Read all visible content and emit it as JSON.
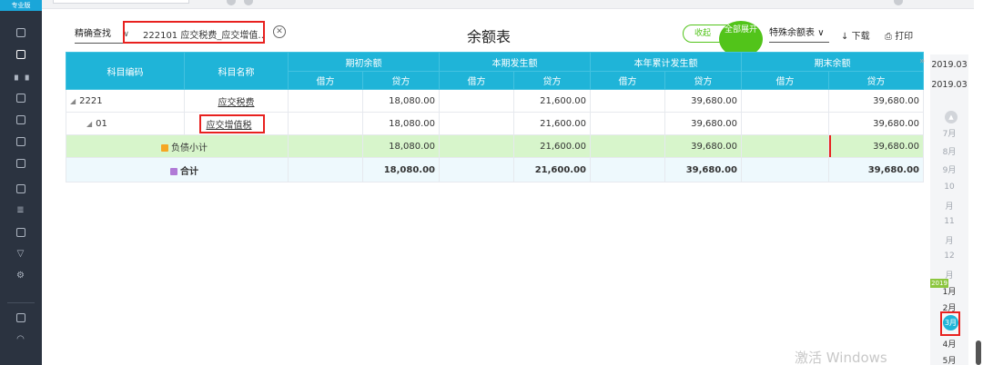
{
  "sidebar": {
    "brand": "专业版",
    "icons": [
      "menu-icon",
      "ledger-icon",
      "chart-icon",
      "report-icon",
      "voucher-icon",
      "book-icon",
      "cart-icon",
      "invoice-icon",
      "asset-icon",
      "tax-icon",
      "shield-icon",
      "settings-icon",
      "monitor-icon",
      "gauge-icon"
    ]
  },
  "toolbar": {
    "search_mode": "精确查找",
    "search_value": "222101  应交税费_应交增值…",
    "title": "余额表",
    "collapse_label": "收起",
    "expand_label": "全部展开",
    "special_label": "特殊余额表",
    "download_label": "下载",
    "print_label": "打印"
  },
  "table": {
    "headers": {
      "code": "科目编码",
      "name": "科目名称",
      "groups": [
        "期初余额",
        "本期发生额",
        "本年累计发生额",
        "期末余额"
      ],
      "debit": "借方",
      "credit": "贷方"
    },
    "rows": [
      {
        "code": "2221",
        "name": "应交税费",
        "values": [
          "",
          "18,080.00",
          "",
          "21,600.00",
          "",
          "39,680.00",
          "",
          "39,680.00"
        ]
      },
      {
        "code": "01",
        "name": "应交增值税",
        "values": [
          "",
          "18,080.00",
          "",
          "21,600.00",
          "",
          "39,680.00",
          "",
          "39,680.00"
        ]
      }
    ],
    "subtotal": {
      "label": "负债小计",
      "values": [
        "",
        "18,080.00",
        "",
        "21,600.00",
        "",
        "39,680.00",
        "",
        "39,680.00"
      ]
    },
    "total": {
      "label": "合计",
      "values": [
        "",
        "18,080.00",
        "",
        "21,600.00",
        "",
        "39,680.00",
        "",
        "39,680.00"
      ]
    }
  },
  "period": {
    "start": "2019.03",
    "end": "2019.03",
    "year": "2019",
    "months_before": [
      "7月",
      "8月",
      "9月",
      "10",
      "月",
      "11",
      "月",
      "12",
      "月"
    ],
    "months_after": [
      "1月",
      "2月"
    ],
    "selected": "3月",
    "months_tail": [
      "4月",
      "5月"
    ]
  },
  "watermark": "激活 Windows"
}
